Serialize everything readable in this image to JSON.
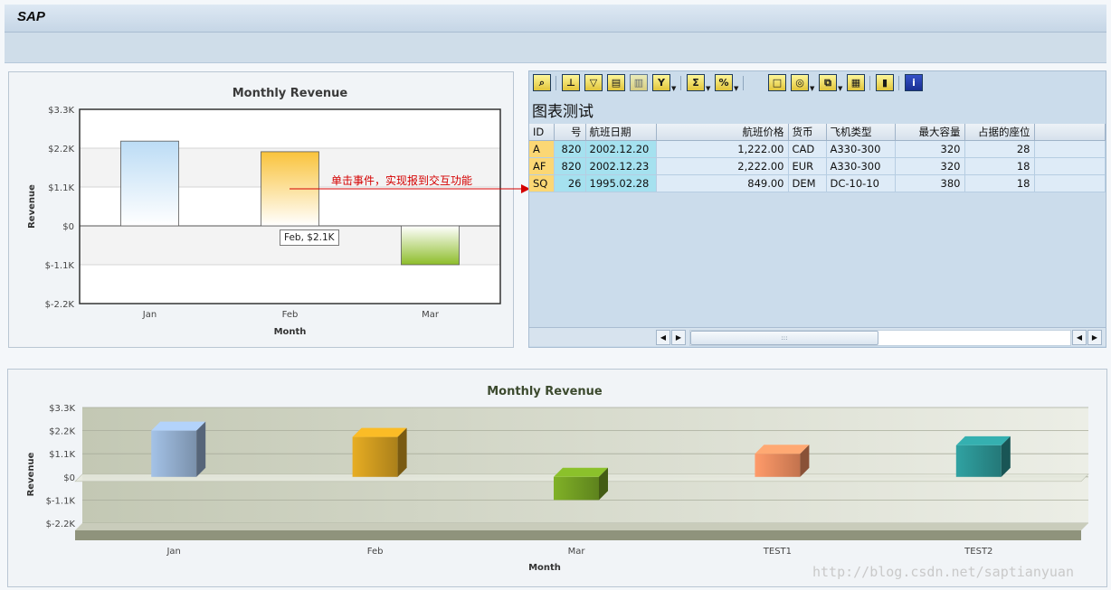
{
  "app": {
    "title": "SAP"
  },
  "chart_top": {
    "title": "Monthly Revenue",
    "xlabel": "Month",
    "ylabel": "Revenue",
    "yticks": [
      "$3.3K",
      "$2.2K",
      "$1.1K",
      "$0",
      "$-1.1K",
      "$-2.2K"
    ],
    "tooltip": "Feb, $2.1K"
  },
  "annotation": "单击事件，实现报到交互功能",
  "alv": {
    "title": "图表测试",
    "columns": [
      "ID",
      "号",
      "航班日期",
      "航班价格",
      "货币",
      "飞机类型",
      "最大容量",
      "占据的座位"
    ],
    "rows": [
      [
        "A",
        "820",
        "2002.12.20",
        "1,222.00",
        "CAD",
        "A330-300",
        "320",
        "28"
      ],
      [
        "AF",
        "820",
        "2002.12.23",
        "2,222.00",
        "EUR",
        "A330-300",
        "320",
        "18"
      ],
      [
        "SQ",
        "26",
        "1995.02.28",
        "849.00",
        "DEM",
        "DC-10-10",
        "380",
        "18"
      ]
    ],
    "toolbar_icons": [
      "details-icon",
      "print-icon",
      "filter-icon",
      "save-icon",
      "find-icon",
      "set-filter-icon",
      "sum-icon",
      "subtotal-icon",
      "print-preview-icon",
      "export-icon",
      "layout-icon",
      "grid-icon",
      "chart-icon",
      "info-icon"
    ]
  },
  "chart_data": [
    {
      "type": "bar",
      "title": "Monthly Revenue",
      "xlabel": "Month",
      "ylabel": "Revenue",
      "categories": [
        "Jan",
        "Feb",
        "Mar"
      ],
      "values": [
        2400,
        2100,
        -1100
      ],
      "ylim": [
        -2200,
        3300
      ],
      "grid": true,
      "colors": [
        "#bcdcf5",
        "#f9c33c",
        "#8dbd2a"
      ]
    },
    {
      "type": "bar",
      "title": "Monthly Revenue",
      "xlabel": "Month",
      "ylabel": "Revenue",
      "categories": [
        "Jan",
        "Feb",
        "Mar",
        "TEST1",
        "TEST2"
      ],
      "values": [
        2200,
        1900,
        -1100,
        1100,
        1500
      ],
      "ylim": [
        -2200,
        3300
      ],
      "grid": true,
      "colors": [
        "#8fa9c9",
        "#c9961e",
        "#6f9a22",
        "#e5875c",
        "#2a8d8d"
      ]
    }
  ],
  "watermark": "http://blog.csdn.net/saptianyuan"
}
